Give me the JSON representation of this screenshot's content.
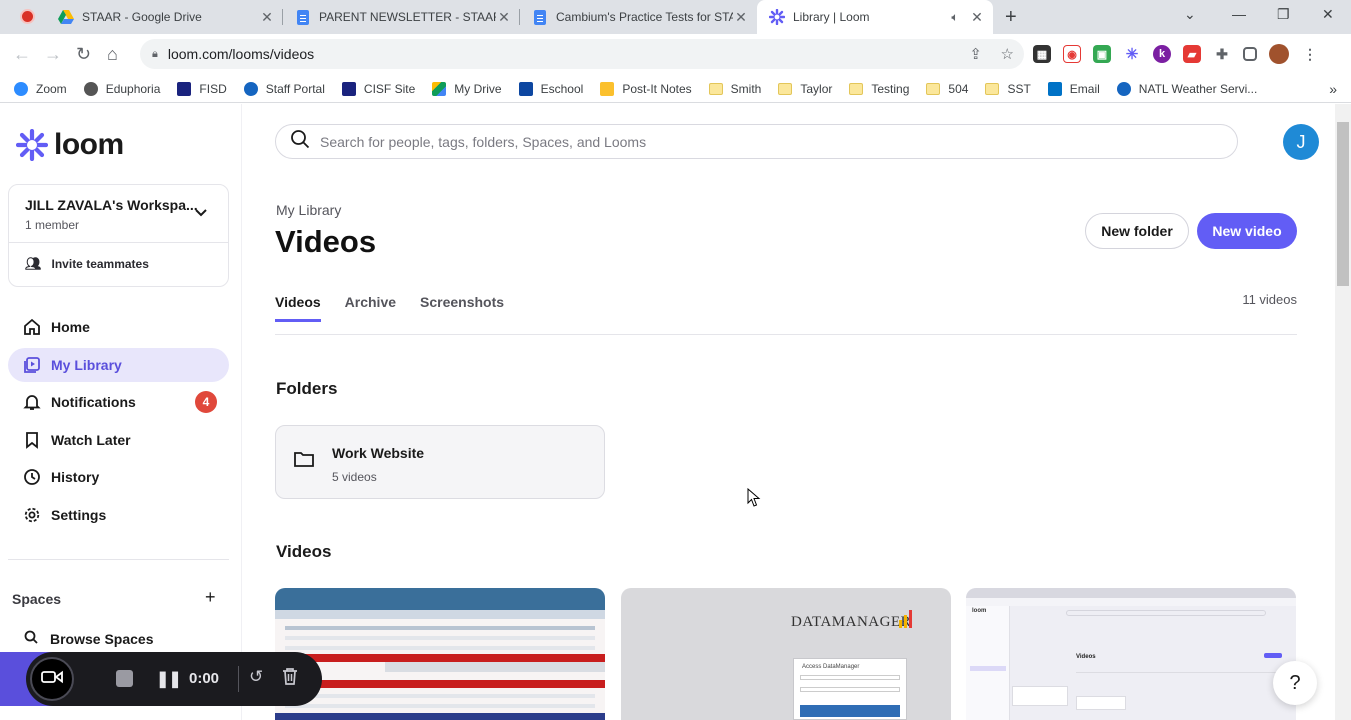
{
  "browser": {
    "tabs": [
      {
        "title": "STAAR - Google Drive",
        "close": "✕"
      },
      {
        "title": "PARENT NEWSLETTER - STAAR D",
        "close": "✕"
      },
      {
        "title": "Cambium's Practice Tests for STA",
        "close": "✕"
      },
      {
        "title": "Library | Loom",
        "close": "✕"
      }
    ],
    "url": "loom.com/looms/videos",
    "bookmarks": [
      "Zoom",
      "Eduphoria",
      "FISD",
      "Staff Portal",
      "CISF Site",
      "My Drive",
      "Eschool",
      "Post-It Notes",
      "Smith",
      "Taylor",
      "Testing",
      "504",
      "SST",
      "Email",
      "NATL Weather Servi..."
    ]
  },
  "sidebar": {
    "logo": "loom",
    "workspace_name": "JILL ZAVALA's Workspa...",
    "workspace_members": "1 member",
    "invite": "Invite teammates",
    "nav": [
      {
        "label": "Home"
      },
      {
        "label": "My Library"
      },
      {
        "label": "Notifications",
        "badge": "4"
      },
      {
        "label": "Watch Later"
      },
      {
        "label": "History"
      },
      {
        "label": "Settings"
      }
    ],
    "spaces_heading": "Spaces",
    "browse_spaces": "Browse Spaces"
  },
  "search": {
    "placeholder": "Search for people, tags, folders, Spaces, and Looms"
  },
  "avatar_initial": "J",
  "main": {
    "breadcrumb": "My Library",
    "title": "Videos",
    "new_folder": "New folder",
    "new_video": "New video",
    "tabs": [
      "Videos",
      "Archive",
      "Screenshots"
    ],
    "count": "11 videos",
    "folders_heading": "Folders",
    "folder": {
      "name": "Work Website",
      "count": "5 videos"
    },
    "videos_heading": "Videos",
    "thumb2_text": "DATAMANAGER",
    "thumb2_login": "Access DataManager",
    "thumb3_logo": "loom",
    "thumb3_title": "Videos"
  },
  "recorder": {
    "timer": "0:00"
  },
  "help": "?"
}
